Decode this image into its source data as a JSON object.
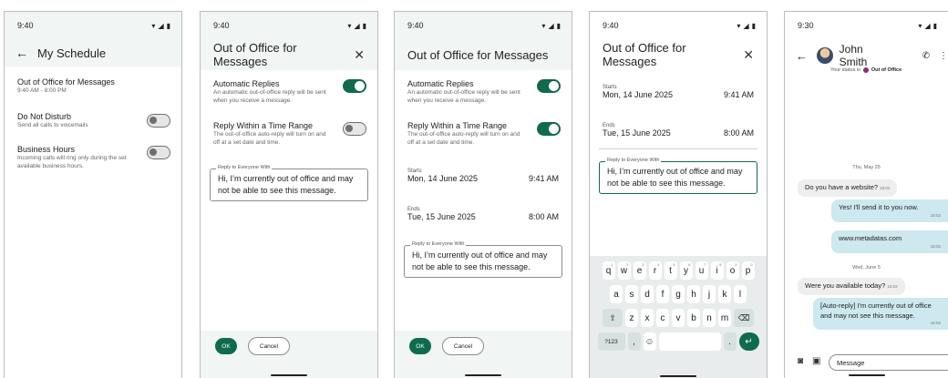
{
  "status": {
    "time_a": "9:40",
    "time_b": "9:30"
  },
  "schedule": {
    "title": "My Schedule",
    "ooo_title": "Out of Office for Messages",
    "ooo_time": "9:40 AM - 8:00 PM",
    "dnd_title": "Do Not Disturb",
    "dnd_sub": "Send all calls to voicemails",
    "bh_title": "Business Hours",
    "bh_sub": "Incoming calls will ring only during the set available business hours."
  },
  "ooo_dialog": {
    "title": "Out of Office for Messages",
    "auto_title": "Automatic Replies",
    "auto_sub": "An automatic out-of-office reply will be sent when you receive a message.",
    "range_title": "Reply Within a Time Range",
    "range_sub": "The out-of-office auto-reply will turn on and off at a set date and time.",
    "reply_label": "Reply to Everyone With",
    "reply_text": "Hi, I’m currently out of office and may not be able to see this message.",
    "starts_label": "Starts",
    "starts_date": "Mon, 14 June 2025",
    "starts_time": "9:41 AM",
    "ends_label": "Ends",
    "ends_date": "Tue, 15 June 2025",
    "ends_time": "8:00 AM",
    "ok_label": "OK",
    "cancel_label": "Cancel"
  },
  "keyboard": {
    "row1": [
      "q",
      "w",
      "e",
      "r",
      "t",
      "y",
      "u",
      "i",
      "o",
      "p"
    ],
    "row1_hints": [
      "1",
      "2",
      "3",
      "4",
      "5",
      "6",
      "7",
      "8",
      "9",
      "0"
    ],
    "row2": [
      "a",
      "s",
      "d",
      "f",
      "g",
      "h",
      "j",
      "k",
      "l"
    ],
    "row3": [
      "z",
      "x",
      "c",
      "v",
      "b",
      "n",
      "m"
    ],
    "sym_label": "?123",
    "comma": ",",
    "dot": ".",
    "shift_icon": "⇧",
    "backspace_icon": "⌫",
    "emoji_icon": "☺",
    "enter_icon": "↵"
  },
  "chat": {
    "name": "John Smith",
    "status_prefix": "Your status is",
    "status_value": "Out of Office",
    "day1": "Thu, May 25",
    "msg1": "Do you have a website?",
    "msg1_time": "15:02",
    "msg2": "Yes! I'll send it to you now.",
    "msg2_time": "15:02",
    "msg3": "www.metadatas.com",
    "msg3_time": "15:02",
    "day2": "Wed, June 5",
    "msg4": "Were you available today?",
    "msg4_time": "15:02",
    "msg5": "[Auto-reply] I'm currently out of office and may not see this message.",
    "msg5_time": "15:02",
    "input_placeholder": "Message"
  },
  "colors": {
    "accent": "#0e6b4e",
    "tint": "#f1f5f4",
    "outgoing": "#cde8ef"
  }
}
